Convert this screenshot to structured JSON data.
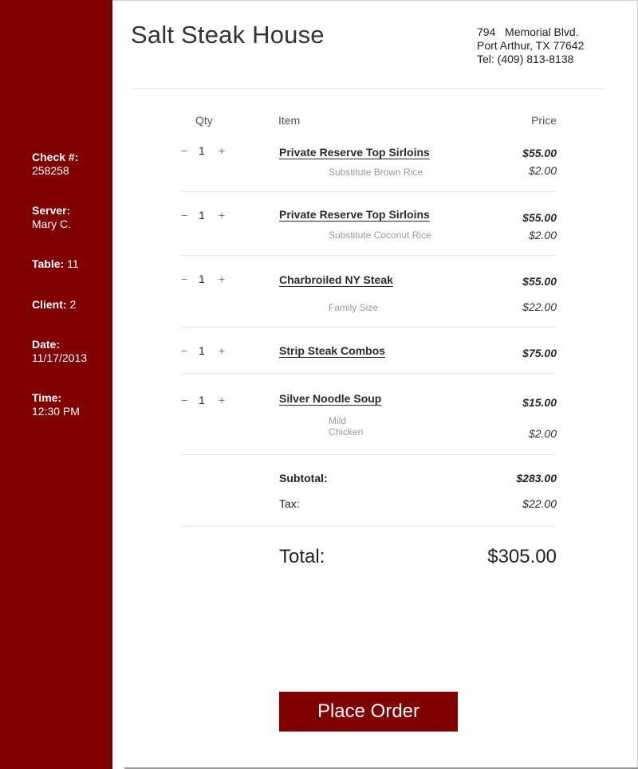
{
  "restaurant": {
    "name": "Salt Steak House",
    "address_line1": "794   Memorial Blvd.",
    "address_line2": "Port Arthur, TX 77642",
    "phone": "Tel: (409) 813-8138"
  },
  "sidebar": {
    "check_label": "Check #:",
    "check_value": "258258",
    "server_label": "Server:",
    "server_value": "Mary C.",
    "table_label": "Table:",
    "table_value": "11",
    "client_label": "Client:",
    "client_value": "2",
    "date_label": "Date:",
    "date_value": "11/17/2013",
    "time_label": "Time:",
    "time_value": "12:30 PM"
  },
  "columns": {
    "qty": "Qty",
    "item": "Item",
    "price": "Price"
  },
  "controls": {
    "minus": "−",
    "plus": "+"
  },
  "items": [
    {
      "qty": "1",
      "name": "Private Reserve Top Sirloins",
      "price": "$55.00",
      "modifier": "Substitute Brown Rice",
      "modifier_price": "$2.00"
    },
    {
      "qty": "1",
      "name": "Private Reserve Top Sirloins",
      "price": "$55.00",
      "modifier": "Substitute Coconut Rice",
      "modifier_price": "$2.00"
    },
    {
      "qty": "1",
      "name": "Charbroiled NY Steak",
      "price": "$55.00",
      "modifier": "Family Size",
      "modifier_price": "$22.00"
    },
    {
      "qty": "1",
      "name": "Strip Steak Combos",
      "price": "$75.00"
    },
    {
      "qty": "1",
      "name": "Silver Noodle Soup",
      "price": "$15.00",
      "modifier": "Mild",
      "modifier2": "Chicken",
      "modifier_price": "$2.00"
    }
  ],
  "summary": {
    "subtotal_label": "Subtotal:",
    "subtotal": "$283.00",
    "tax_label": "Tax:",
    "tax": "$22.00",
    "total_label": "Total:",
    "total": "$305.00"
  },
  "actions": {
    "place_order": "Place Order"
  },
  "colors": {
    "brand": "#800000",
    "sidebar_text": "#ffffff"
  }
}
